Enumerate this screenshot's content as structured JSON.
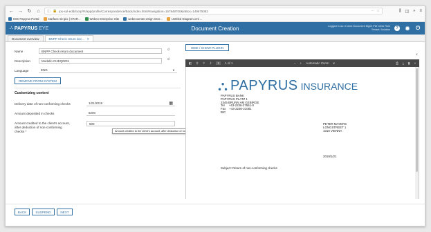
{
  "browser": {
    "url": "ips-sol-edd/loorp/#!/app/profile/Correspondence/Back/index.html#navigation=157848700&inBox=149675082",
    "bookmarks": [
      "ISIS Papyrus Portal",
      "starface-sit-ipix | STAR...",
      "Webex Enterprise Site",
      "webexcenter.eSign Inter...",
      "Untitled Diagram.xml ..."
    ],
    "bookmark_colors": [
      "#2f6fa3",
      "#e8a13a",
      "#2a8d4a",
      "#2f6fa3",
      "#e8a13a"
    ]
  },
  "app": {
    "logo_bold": "PAPYRUS",
    "logo_light": "EYE",
    "title": "Document Creation",
    "user_line1": "Logged in as: rf.clerk Document Mgmt FW Clerk Role",
    "user_line2": "Tenant: Solution"
  },
  "tabs": [
    {
      "label": "Document overview"
    },
    {
      "label": "BNPP Check return doc...",
      "close": "×"
    }
  ],
  "form": {
    "name_label": "Name",
    "name_value": "BNPP Check return document",
    "desc_label": "Description",
    "desc_value": "Modello CHEQ0201",
    "lang_label": "Language",
    "lang_value": "ENG",
    "remove_button": "REMOVE FROM SYSTEM",
    "section_title": "Customizing content",
    "delivery_label": "Delivery date of non-conforming checks",
    "delivery_value": "1/21/2019",
    "deposited_label": "Amount deposited in checks",
    "deposited_value": "8200",
    "credited_label_1": "Amount credited to the client's account,",
    "credited_label_2": "after deduction of non-conforming",
    "credited_label_3": "checks *",
    "credited_value": "500",
    "tooltip": "Amount credited to the client's account, after deduction of non-conforming checks *"
  },
  "buttons": {
    "back": "BACK",
    "suspend": "SUSPEND",
    "next": "NEXT",
    "plugin": "HIDE / SHOW PLUGIN"
  },
  "pdf": {
    "page_indicator": "1 of 1",
    "page_number": "1",
    "zoom": "Automatic Zoom",
    "logo_main": "PAPYRUS",
    "logo_sub": "INSURANCE",
    "sender": [
      "PAPYRUS BANK",
      "PAPYRUS PLATZ 1",
      "2345 BRUNN AM GEBIRGE",
      "Tel     +43-2236-27551-0",
      "Fax    +43-2236-21081",
      "BIC"
    ],
    "recipient": [
      "PETER MAYERS",
      "LONGSTREET 1",
      "1010 VIENNA"
    ],
    "date": "2019/1/21",
    "subject": "Subject: Return of non-conforming checks"
  }
}
